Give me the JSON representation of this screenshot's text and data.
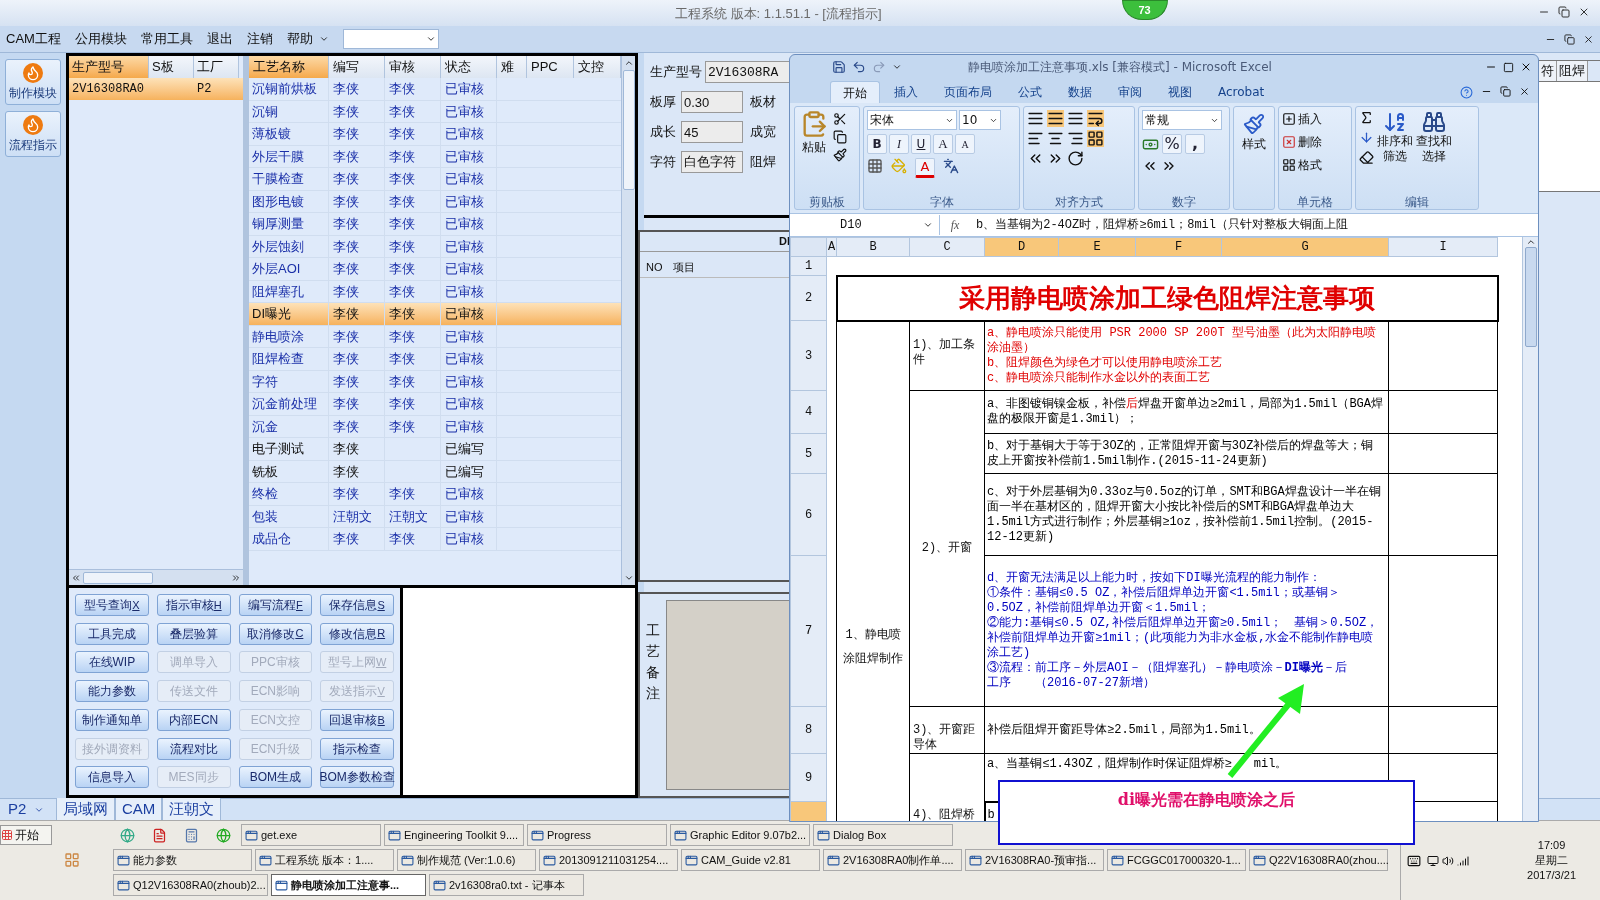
{
  "title_bar": {
    "title": "工程系统  版本: 1.1.51.1 - [流程指示]",
    "badge": "73"
  },
  "menu": {
    "items": [
      "CAM工程",
      "公用模块",
      "常用工具",
      "退出",
      "注销",
      "帮助"
    ]
  },
  "sidebar": [
    {
      "label": "制作模块"
    },
    {
      "label": "流程指示"
    }
  ],
  "models_table": {
    "columns": [
      "生产型号",
      "S板",
      "工厂"
    ],
    "rows": [
      {
        "model": "2V16308RA0",
        "factory": "P2",
        "selected": true
      }
    ]
  },
  "process_table": {
    "columns": [
      "工艺名称",
      "编写",
      "审核",
      "状态",
      "难",
      "PPC",
      "文控"
    ],
    "rows": [
      {
        "name": "沉铜前烘板",
        "writer": "李侠",
        "reviewer": "李侠",
        "status": "已审核",
        "reviewed": true,
        "selected": false
      },
      {
        "name": "沉铜",
        "writer": "李侠",
        "reviewer": "李侠",
        "status": "已审核",
        "reviewed": true,
        "selected": false
      },
      {
        "name": "薄板镀",
        "writer": "李侠",
        "reviewer": "李侠",
        "status": "已审核",
        "reviewed": true,
        "selected": false
      },
      {
        "name": "外层干膜",
        "writer": "李侠",
        "reviewer": "李侠",
        "status": "已审核",
        "reviewed": true,
        "selected": false
      },
      {
        "name": "干膜检查",
        "writer": "李侠",
        "reviewer": "李侠",
        "status": "已审核",
        "reviewed": true,
        "selected": false
      },
      {
        "name": "图形电镀",
        "writer": "李侠",
        "reviewer": "李侠",
        "status": "已审核",
        "reviewed": true,
        "selected": false
      },
      {
        "name": "铜厚测量",
        "writer": "李侠",
        "reviewer": "李侠",
        "status": "已审核",
        "reviewed": true,
        "selected": false
      },
      {
        "name": "外层蚀刻",
        "writer": "李侠",
        "reviewer": "李侠",
        "status": "已审核",
        "reviewed": true,
        "selected": false
      },
      {
        "name": "外层AOI",
        "writer": "李侠",
        "reviewer": "李侠",
        "status": "已审核",
        "reviewed": true,
        "selected": false
      },
      {
        "name": "阻焊塞孔",
        "writer": "李侠",
        "reviewer": "李侠",
        "status": "已审核",
        "reviewed": true,
        "selected": false
      },
      {
        "name": "DI曝光",
        "writer": "李侠",
        "reviewer": "李侠",
        "status": "已审核",
        "reviewed": true,
        "selected": true
      },
      {
        "name": "静电喷涂",
        "writer": "李侠",
        "reviewer": "李侠",
        "status": "已审核",
        "reviewed": true,
        "selected": false
      },
      {
        "name": "阻焊检查",
        "writer": "李侠",
        "reviewer": "李侠",
        "status": "已审核",
        "reviewed": true,
        "selected": false
      },
      {
        "name": "字符",
        "writer": "李侠",
        "reviewer": "李侠",
        "status": "已审核",
        "reviewed": true,
        "selected": false
      },
      {
        "name": "沉金前处理",
        "writer": "李侠",
        "reviewer": "李侠",
        "status": "已审核",
        "reviewed": true,
        "selected": false
      },
      {
        "name": "沉金",
        "writer": "李侠",
        "reviewer": "李侠",
        "status": "已审核",
        "reviewed": true,
        "selected": false
      },
      {
        "name": "电子测试",
        "writer": "李侠",
        "status": "已编写",
        "reviewed": false,
        "selected": false
      },
      {
        "name": "铣板",
        "writer": "李侠",
        "status": "已编写",
        "reviewed": false,
        "selected": false
      },
      {
        "name": "终检",
        "writer": "李侠",
        "reviewer": "李侠",
        "status": "已审核",
        "reviewed": true,
        "selected": false
      },
      {
        "name": "包装",
        "writer": "汪朝文",
        "reviewer": "汪朝文",
        "status": "已审核",
        "reviewed": true,
        "selected": false
      },
      {
        "name": "成品仓",
        "writer": "李侠",
        "reviewer": "李侠",
        "status": "已审核",
        "reviewed": true,
        "selected": false
      }
    ]
  },
  "buttons": [
    {
      "label": "型号查询",
      "hotkey": "X",
      "enabled": true
    },
    {
      "label": "指示审核",
      "hotkey": "H",
      "enabled": true
    },
    {
      "label": "编写流程",
      "hotkey": "F",
      "enabled": true
    },
    {
      "label": "保存信息",
      "hotkey": "S",
      "enabled": true
    },
    {
      "label": "工具完成",
      "enabled": true
    },
    {
      "label": "叠层验算",
      "enabled": true
    },
    {
      "label": "取消修改",
      "hotkey": "C",
      "enabled": true
    },
    {
      "label": "修改信息",
      "hotkey": "R",
      "enabled": true
    },
    {
      "label": "在线WIP",
      "enabled": true
    },
    {
      "label": "调单导入",
      "enabled": false
    },
    {
      "label": "PPC审核",
      "enabled": false
    },
    {
      "label": "型号上网",
      "hotkey": "W",
      "enabled": false
    },
    {
      "label": "能力参数",
      "enabled": true
    },
    {
      "label": "传送文件",
      "enabled": false
    },
    {
      "label": "ECN影响",
      "enabled": false
    },
    {
      "label": "发送指示",
      "hotkey": "V",
      "enabled": false
    },
    {
      "label": "制作通知单",
      "enabled": true
    },
    {
      "label": "内部ECN",
      "enabled": true
    },
    {
      "label": "ECN文控",
      "enabled": false
    },
    {
      "label": "回退审核",
      "hotkey": "B",
      "enabled": true
    },
    {
      "label": "接外调资料",
      "enabled": false
    },
    {
      "label": "流程对比",
      "enabled": true
    },
    {
      "label": "ECN升级",
      "enabled": false
    },
    {
      "label": "指示检查",
      "enabled": true
    },
    {
      "label": "信息导入",
      "enabled": true
    },
    {
      "label": "MES同步",
      "enabled": false
    },
    {
      "label": "BOM生成",
      "enabled": true
    },
    {
      "label": "BOM参数检查",
      "enabled": true
    }
  ],
  "info_panel": {
    "model": {
      "label": "生产型号",
      "value": "2V16308RA"
    },
    "fields": [
      {
        "label": "板厚",
        "value": "0.30",
        "next_label": "板材"
      },
      {
        "label": "成长",
        "value": "45",
        "next_label": "成宽"
      },
      {
        "label": "字符",
        "value": "白色字符",
        "next_label": "阻焊"
      }
    ]
  },
  "di_panel": {
    "title": "DI",
    "columns": [
      "NO",
      "项目"
    ]
  },
  "remarks": {
    "label": "工艺备注"
  },
  "right_strip": {
    "columns": [
      "符",
      "阻焊"
    ]
  },
  "status_bar": {
    "factory": "P2",
    "items": [
      "局域网",
      "CAM",
      "汪朝文"
    ]
  },
  "excel": {
    "title": "静电喷涂加工注意事项.xls  [兼容模式] - Microsoft Excel",
    "tabs": [
      {
        "label": "开始",
        "selected": true
      },
      {
        "label": "插入",
        "selected": false
      },
      {
        "label": "页面布局",
        "selected": false
      },
      {
        "label": "公式",
        "selected": false
      },
      {
        "label": "数据",
        "selected": false
      },
      {
        "label": "审阅",
        "selected": false
      },
      {
        "label": "视图",
        "selected": false
      },
      {
        "label": "Acrobat",
        "selected": false
      }
    ],
    "ribbon": {
      "paste": "粘贴",
      "font_name": "宋体",
      "font_size": "10",
      "bold": "B",
      "italic": "I",
      "underline": "U",
      "grow": "A",
      "shrink": "A",
      "font_color": "A",
      "number_format": "常规",
      "percent": "%",
      "comma": ",",
      "styles": "样式",
      "insert": "插入",
      "delete": "删除",
      "format": "格式",
      "sort": [
        "排序和",
        "筛选"
      ],
      "find": [
        "查找和",
        "选择"
      ],
      "groups": [
        "剪贴板",
        "字体",
        "对齐方式",
        "数字",
        "单元格",
        "编辑"
      ]
    },
    "name_box": "D10",
    "function_label": "fx",
    "formula": "b、当基铜为2-4OZ时，阻焊桥≥6mil；8mil（只针对整板大铜面上阻",
    "columns": [
      {
        "label": "A",
        "selected": false
      },
      {
        "label": "B",
        "selected": false
      },
      {
        "label": "C",
        "selected": false
      },
      {
        "label": "D",
        "selected": true
      },
      {
        "label": "E",
        "selected": true
      },
      {
        "label": "F",
        "selected": true
      },
      {
        "label": "G",
        "selected": true
      },
      {
        "label": "I",
        "selected": false
      }
    ],
    "row_numbers": [
      "1",
      "2",
      "3",
      "4",
      "5",
      "6",
      "7",
      "8",
      "9"
    ],
    "sheet": {
      "title": "采用静电喷涂加工绿色阻焊注意事项",
      "section": "1、静电喷涂阻焊制作",
      "groups": [
        {
          "label": "1)、加工条件",
          "items": [
            {
              "kind": "text",
              "color": "#e00000",
              "selected": false,
              "paragraphs": [
                "a、静电喷涂只能使用 PSR 2000 SP 200T 型号油墨（此为太阳静电喷涂油墨）",
                "b、阻焊颜色为绿色才可以使用静电喷涂工艺",
                "c、静电喷涂只能制作水金以外的表面工艺"
              ]
            }
          ]
        },
        {
          "label": "2)、开窗",
          "items": [
            {
              "kind": "text",
              "color": "#000000",
              "selected": false,
              "paragraphs": [
                [
                  {
                    "text": "a、非图镀铜镍金板，补偿",
                    "emphasis": false
                  },
                  {
                    "text": "后",
                    "emphasis": true
                  },
                  {
                    "text": "焊盘开窗单边≥2mil，局部为1.5mil（BGA焊盘的极限开窗是1.3mil）；",
                    "emphasis": false
                  }
                ]
              ]
            },
            {
              "kind": "text",
              "color": "#000000",
              "selected": false,
              "paragraphs": [
                "b、对于基铜大于等于3OZ的，正常阻焊开窗与3OZ补偿后的焊盘等大；铜皮上开窗按补偿前1.5mil制作.(2015-11-24更新)"
              ]
            },
            {
              "kind": "text",
              "color": "#000000",
              "selected": false,
              "paragraphs": [
                "c、对于外层基铜为0.33oz与0.5oz的订单，SMT和BGA焊盘设计一半在铜面一半在基材区的，阻焊开窗大小按比补偿后的SMT和BGA焊盘单边大1.5mil方式进行制作；外层基铜≥1oz，按补偿前1.5mil控制。(2015-12-12更新)"
              ]
            },
            {
              "kind": "text",
              "color": "#0000c0",
              "selected": false,
              "paragraphs": [
                "d、开窗无法满足以上能力时，按如下DI曝光流程的能力制作：",
                "①条件：基铜≤0.5 OZ，补偿后阻焊单边开窗<1.5mil；或基铜＞0.5OZ，补偿前阻焊单边开窗＜1.5mil；",
                "②能力:基铜≤0.5 OZ,补偿后阻焊单边开窗≥0.5mil；　基铜＞0.5OZ，补偿前阻焊单边开窗≥1mil；(此项能力为非水金板,水金不能制作静电喷涂工艺)",
                "③流程：前工序－外层AOI－（阻焊塞孔）－静电喷涂－**DI曝光**－后",
                "工序　　（2016-07-27新增）"
              ]
            }
          ]
        },
        {
          "label": "3)、开窗距导体",
          "items": [
            {
              "kind": "text",
              "color": "#000000",
              "selected": false,
              "paragraphs": [
                "补偿后阻焊开窗距导体≥2.5mil，局部为1.5mil。"
              ]
            }
          ]
        },
        {
          "label": "4)、阻焊桥",
          "items": [
            {
              "kind": "split",
              "color": "#000000",
              "selected": false,
              "parts": [
                "a、当基铜≤1.43OZ，阻焊制作时保证阻焊桥≥",
                "mil。"
              ]
            },
            {
              "kind": "text",
              "selected": true,
              "paragraphs": [
                "b"
              ]
            }
          ]
        }
      ]
    }
  },
  "annotation": {
    "text": "di曝光需在静电喷涂之后"
  },
  "taskbar": {
    "start": "开始",
    "tasks": [
      {
        "label": "get.exe",
        "active": false
      },
      {
        "label": "Engineering Toolkit 9....",
        "active": false
      },
      {
        "label": "Progress",
        "active": false
      },
      {
        "label": "Graphic Editor 9.07b2...",
        "active": false
      },
      {
        "label": "Dialog Box",
        "active": false
      },
      {
        "label": "能力参数",
        "active": false
      },
      {
        "label": "工程系统  版本：1....",
        "active": false
      },
      {
        "label": "制作规范 (Ver:1.0.6)",
        "active": false
      },
      {
        "label": "2013091211031254....",
        "active": false
      },
      {
        "label": "CAM_Guide v2.81",
        "active": false
      },
      {
        "label": "2V16308RA0制作单....",
        "active": false
      },
      {
        "label": "2V16308RA0-预审指...",
        "active": false
      },
      {
        "label": "FCGGC017000320-1...",
        "active": false
      },
      {
        "label": "Q22V16308RA0(zhou....",
        "active": false
      },
      {
        "label": "Q12V16308RA0(zhoub)2...",
        "active": false
      },
      {
        "label": "静电喷涂加工注意事...",
        "active": true
      },
      {
        "label": "2v16308ra0.txt - 记事本",
        "active": false
      }
    ],
    "clock": {
      "time": "17:09",
      "day": "星期二",
      "date": "2017/3/21"
    }
  }
}
